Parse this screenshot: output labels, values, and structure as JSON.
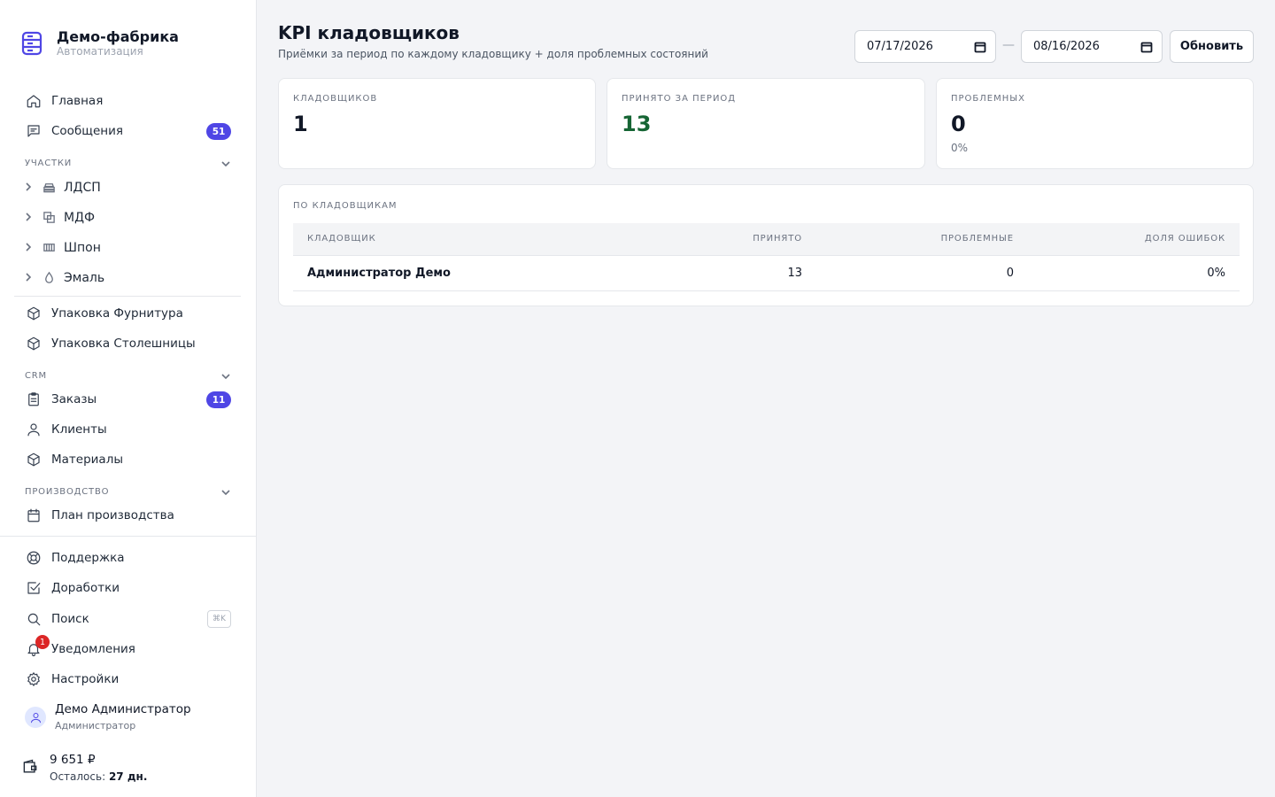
{
  "brand": {
    "title": "Демо-фабрика",
    "subtitle": "Автоматизация"
  },
  "nav": {
    "home": "Главная",
    "messages": {
      "label": "Сообщения",
      "badge": "51"
    },
    "sections": {
      "uchastki": "УЧАСТКИ",
      "crm": "CRM",
      "production": "ПРОИЗВОДСТВО"
    },
    "uchastki_items": [
      "ЛДСП",
      "МДФ",
      "Шпон",
      "Эмаль"
    ],
    "packaging": [
      "Упаковка Фурнитура",
      "Упаковка Столешницы"
    ],
    "orders": {
      "label": "Заказы",
      "badge": "11"
    },
    "clients": "Клиенты",
    "materials": "Материалы",
    "plan": "План производства",
    "support": "Поддержка",
    "improvements": "Доработки",
    "search": {
      "label": "Поиск",
      "shortcut": "⌘K"
    },
    "notifications": {
      "label": "Уведомления",
      "count": "1"
    },
    "settings": "Настройки"
  },
  "user": {
    "name": "Демо Администратор",
    "role": "Администратор"
  },
  "wallet": {
    "amount": "9 651 ₽",
    "left_label": "Осталось:",
    "left_value": "27 дн."
  },
  "header": {
    "title": "KPI кладовщиков",
    "subtitle": "Приёмки за период по каждому кладовщику + доля проблемных состояний",
    "date_from": "07/17/2026",
    "date_sep": "—",
    "date_to": "08/16/2026",
    "refresh": "Обновить"
  },
  "cards": [
    {
      "label": "КЛАДОВЩИКОВ",
      "value": "1",
      "extra": ""
    },
    {
      "label": "ПРИНЯТО ЗА ПЕРИОД",
      "value": "13",
      "extra": ""
    },
    {
      "label": "ПРОБЛЕМНЫХ",
      "value": "0",
      "extra": "0%"
    }
  ],
  "table": {
    "title": "ПО КЛАДОВЩИКАМ",
    "columns": [
      "КЛАДОВЩИК",
      "ПРИНЯТО",
      "ПРОБЛЕМНЫЕ",
      "ДОЛЯ ОШИБОК"
    ],
    "rows": [
      [
        "Администратор Демо",
        "13",
        "0",
        "0%"
      ]
    ]
  },
  "colors": {
    "accent": "#4f46e5",
    "positive": "#166534",
    "danger": "#dc2626"
  }
}
